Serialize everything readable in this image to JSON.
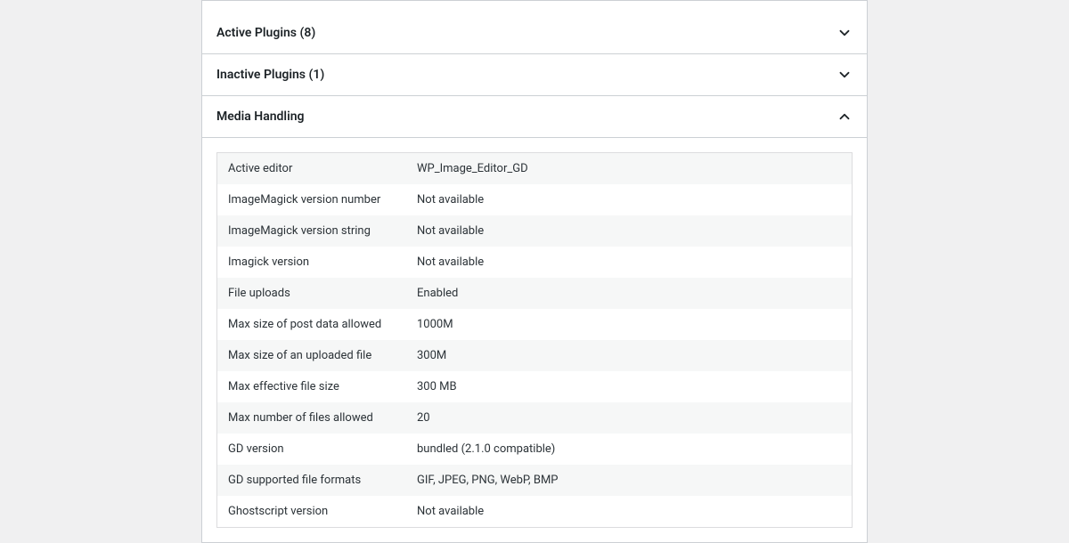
{
  "panels": [
    {
      "title": "Active Plugins (8)",
      "expanded": false
    },
    {
      "title": "Inactive Plugins (1)",
      "expanded": false
    },
    {
      "title": "Media Handling",
      "expanded": true,
      "rows": [
        {
          "label": "Active editor",
          "value": "WP_Image_Editor_GD"
        },
        {
          "label": "ImageMagick version number",
          "value": "Not available"
        },
        {
          "label": "ImageMagick version string",
          "value": "Not available"
        },
        {
          "label": "Imagick version",
          "value": "Not available"
        },
        {
          "label": "File uploads",
          "value": "Enabled"
        },
        {
          "label": "Max size of post data allowed",
          "value": "1000M"
        },
        {
          "label": "Max size of an uploaded file",
          "value": "300M"
        },
        {
          "label": "Max effective file size",
          "value": "300 MB"
        },
        {
          "label": "Max number of files allowed",
          "value": "20"
        },
        {
          "label": "GD version",
          "value": "bundled (2.1.0 compatible)"
        },
        {
          "label": "GD supported file formats",
          "value": "GIF, JPEG, PNG, WebP, BMP"
        },
        {
          "label": "Ghostscript version",
          "value": "Not available"
        }
      ]
    }
  ]
}
